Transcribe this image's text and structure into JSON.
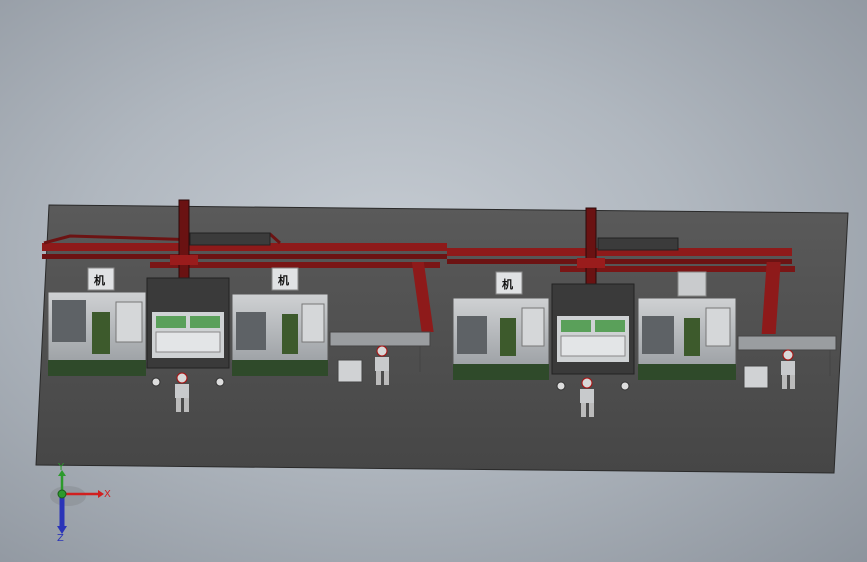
{
  "viewport": {
    "background": "#aeb5bd"
  },
  "machine_labels": [
    "机",
    "机",
    "机"
  ],
  "triad": {
    "x_label": "X",
    "y_label": "Y",
    "z_label": "Z"
  },
  "colors": {
    "floor": "#4f4f4f",
    "gantry": "#8e1a1a",
    "machine_body": "#b9bcbf",
    "machine_base": "#2f4a2a",
    "cell_frame": "#3a3a3a",
    "axis_x": "#d11f1f",
    "axis_y": "#2c9a2c",
    "axis_z": "#2a34b8"
  }
}
